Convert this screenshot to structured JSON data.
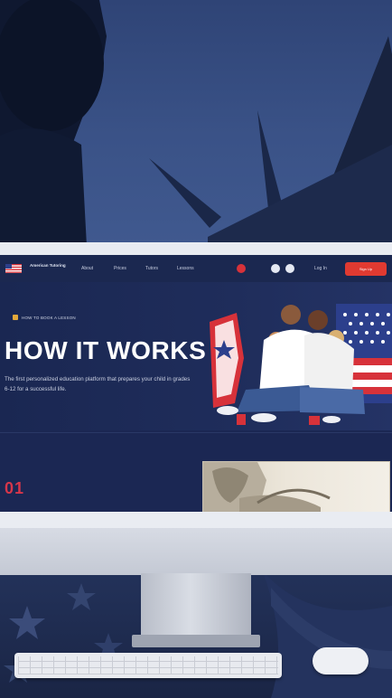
{
  "website": {
    "nav": {
      "logo_text": "American Tutoring",
      "links": [
        "About",
        "Prices",
        "Tutors",
        "Lessons"
      ],
      "login_label": "Log In",
      "signup_label": "Sign Up"
    },
    "hero": {
      "eyebrow": "HOW TO BOOK A LESSON",
      "title": "HOW IT WORKS",
      "subtitle": "The first personalized education platform that prepares your child in grades 6-12 for a successful life."
    },
    "step": {
      "number": "01"
    }
  },
  "colors": {
    "accent_red": "#e03a31",
    "navy": "#1b2850",
    "step_number": "#d7364a"
  }
}
